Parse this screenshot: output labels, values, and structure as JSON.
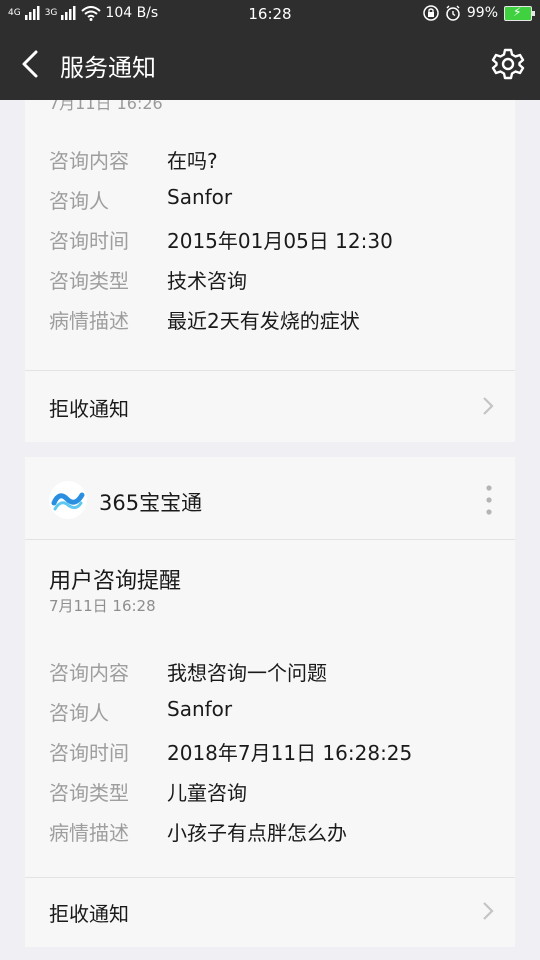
{
  "status_bar": {
    "net_1": "4G",
    "net_2": "3G",
    "speed": "104 B/s",
    "time": "16:28",
    "battery": "99%"
  },
  "header": {
    "title": "服务通知"
  },
  "card1": {
    "date_time": "7月11日  16:26",
    "fields": [
      {
        "label": "咨询内容",
        "value": "在吗?"
      },
      {
        "label": "咨询人",
        "value": "Sanfor"
      },
      {
        "label": "咨询时间",
        "value": "2015年01月05日 12:30"
      },
      {
        "label": "咨询类型",
        "value": "技术咨询"
      },
      {
        "label": "病情描述",
        "value": "最近2天有发烧的症状"
      }
    ],
    "reject_label": "拒收通知"
  },
  "card2": {
    "app_name": "365宝宝通",
    "title": "用户咨询提醒",
    "date_time": "7月11日  16:28",
    "fields": [
      {
        "label": "咨询内容",
        "value": "我想咨询一个问题"
      },
      {
        "label": "咨询人",
        "value": "Sanfor"
      },
      {
        "label": "咨询时间",
        "value": "2018年7月11日 16:28:25"
      },
      {
        "label": "咨询类型",
        "value": "儿童咨询"
      },
      {
        "label": "病情描述",
        "value": "小孩子有点胖怎么办"
      }
    ],
    "reject_label": "拒收通知"
  },
  "icons": {
    "back": "back-arrow-icon",
    "settings": "gear-icon",
    "chevron": "chevron-right-icon",
    "more": "more-vertical-icon",
    "app": "app-logo-icon"
  },
  "colors": {
    "bar_bg": "#2e2e2e",
    "page_bg": "#efeff4",
    "card_bg": "#f7f7f7",
    "label_grey": "#9e9e9e",
    "battery_green": "#3fd13f"
  }
}
